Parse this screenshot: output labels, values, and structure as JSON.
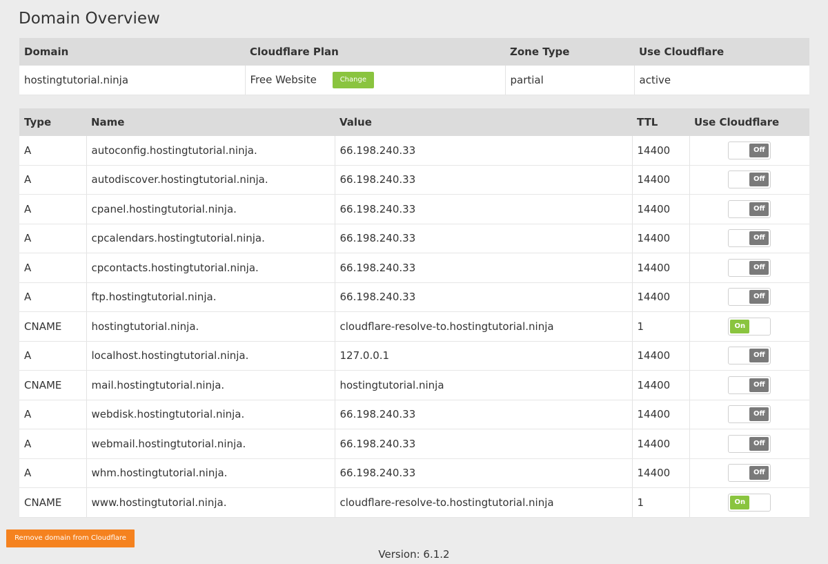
{
  "page": {
    "title": "Domain Overview",
    "version": "Version: 6.1.2",
    "remove_button": "Remove domain from Cloudflare"
  },
  "overview": {
    "headers": {
      "domain": "Domain",
      "plan": "Cloudflare Plan",
      "zone_type": "Zone Type",
      "use_cloudflare": "Use Cloudflare"
    },
    "row": {
      "domain": "hostingtutorial.ninja",
      "plan": "Free Website",
      "change_button": "Change",
      "zone_type": "partial",
      "use_cloudflare": "active"
    }
  },
  "records": {
    "headers": {
      "type": "Type",
      "name": "Name",
      "value": "Value",
      "ttl": "TTL",
      "use_cloudflare": "Use Cloudflare"
    },
    "toggle_labels": {
      "on": "On",
      "off": "Off"
    },
    "rows": [
      {
        "type": "A",
        "name": "autoconfig.hostingtutorial.ninja.",
        "value": "66.198.240.33",
        "ttl": "14400",
        "cloudflare": "off"
      },
      {
        "type": "A",
        "name": "autodiscover.hostingtutorial.ninja.",
        "value": "66.198.240.33",
        "ttl": "14400",
        "cloudflare": "off"
      },
      {
        "type": "A",
        "name": "cpanel.hostingtutorial.ninja.",
        "value": "66.198.240.33",
        "ttl": "14400",
        "cloudflare": "off"
      },
      {
        "type": "A",
        "name": "cpcalendars.hostingtutorial.ninja.",
        "value": "66.198.240.33",
        "ttl": "14400",
        "cloudflare": "off"
      },
      {
        "type": "A",
        "name": "cpcontacts.hostingtutorial.ninja.",
        "value": "66.198.240.33",
        "ttl": "14400",
        "cloudflare": "off"
      },
      {
        "type": "A",
        "name": "ftp.hostingtutorial.ninja.",
        "value": "66.198.240.33",
        "ttl": "14400",
        "cloudflare": "off"
      },
      {
        "type": "CNAME",
        "name": "hostingtutorial.ninja.",
        "value": "cloudflare-resolve-to.hostingtutorial.ninja",
        "ttl": "1",
        "cloudflare": "on"
      },
      {
        "type": "A",
        "name": "localhost.hostingtutorial.ninja.",
        "value": "127.0.0.1",
        "ttl": "14400",
        "cloudflare": "off"
      },
      {
        "type": "CNAME",
        "name": "mail.hostingtutorial.ninja.",
        "value": "hostingtutorial.ninja",
        "ttl": "14400",
        "cloudflare": "off"
      },
      {
        "type": "A",
        "name": "webdisk.hostingtutorial.ninja.",
        "value": "66.198.240.33",
        "ttl": "14400",
        "cloudflare": "off"
      },
      {
        "type": "A",
        "name": "webmail.hostingtutorial.ninja.",
        "value": "66.198.240.33",
        "ttl": "14400",
        "cloudflare": "off"
      },
      {
        "type": "A",
        "name": "whm.hostingtutorial.ninja.",
        "value": "66.198.240.33",
        "ttl": "14400",
        "cloudflare": "off"
      },
      {
        "type": "CNAME",
        "name": "www.hostingtutorial.ninja.",
        "value": "cloudflare-resolve-to.hostingtutorial.ninja",
        "ttl": "1",
        "cloudflare": "on"
      }
    ]
  },
  "colors": {
    "background": "#ececec",
    "header_bg": "#dcdcdc",
    "toggle_on": "#8ac43f",
    "toggle_off": "#7a7a7a",
    "change_button": "#8ac43f",
    "remove_button": "#f5821f"
  }
}
